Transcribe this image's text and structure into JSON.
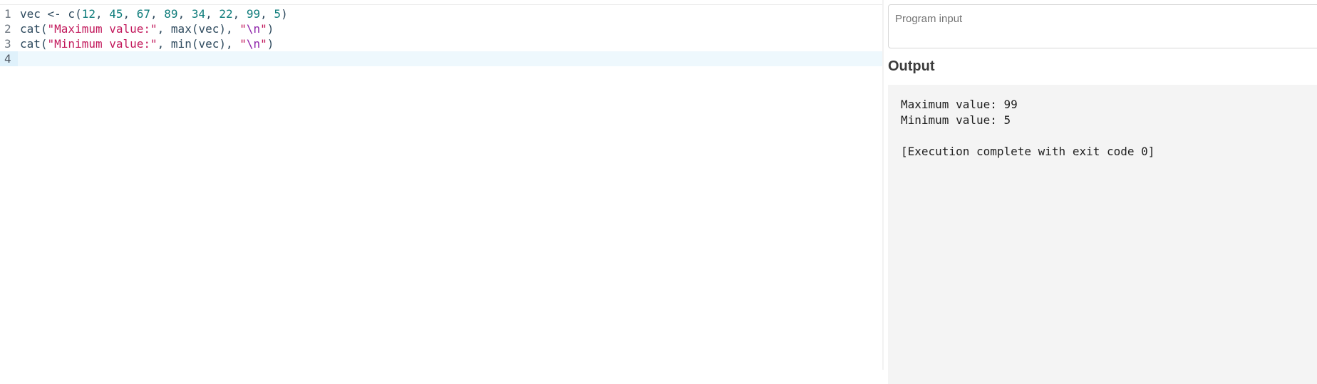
{
  "editor": {
    "lines": [
      {
        "number": "1",
        "tokens": [
          {
            "t": "vec <- c(",
            "k": "plain"
          },
          {
            "t": "12",
            "k": "num"
          },
          {
            "t": ", ",
            "k": "plain"
          },
          {
            "t": "45",
            "k": "num"
          },
          {
            "t": ", ",
            "k": "plain"
          },
          {
            "t": "67",
            "k": "num"
          },
          {
            "t": ", ",
            "k": "plain"
          },
          {
            "t": "89",
            "k": "num"
          },
          {
            "t": ", ",
            "k": "plain"
          },
          {
            "t": "34",
            "k": "num"
          },
          {
            "t": ", ",
            "k": "plain"
          },
          {
            "t": "22",
            "k": "num"
          },
          {
            "t": ", ",
            "k": "plain"
          },
          {
            "t": "99",
            "k": "num"
          },
          {
            "t": ", ",
            "k": "plain"
          },
          {
            "t": "5",
            "k": "num"
          },
          {
            "t": ")",
            "k": "plain"
          }
        ]
      },
      {
        "number": "2",
        "tokens": [
          {
            "t": "cat(",
            "k": "plain"
          },
          {
            "t": "\"Maximum value:\"",
            "k": "str"
          },
          {
            "t": ", max(vec), ",
            "k": "plain"
          },
          {
            "t": "\"",
            "k": "str"
          },
          {
            "t": "\\n",
            "k": "esc"
          },
          {
            "t": "\"",
            "k": "str"
          },
          {
            "t": ")",
            "k": "plain"
          }
        ]
      },
      {
        "number": "3",
        "tokens": [
          {
            "t": "cat(",
            "k": "plain"
          },
          {
            "t": "\"Minimum value:\"",
            "k": "str"
          },
          {
            "t": ", min(vec), ",
            "k": "plain"
          },
          {
            "t": "\"",
            "k": "str"
          },
          {
            "t": "\\n",
            "k": "esc"
          },
          {
            "t": "\"",
            "k": "str"
          },
          {
            "t": ")",
            "k": "plain"
          }
        ]
      },
      {
        "number": "4",
        "active": true,
        "tokens": []
      }
    ]
  },
  "input": {
    "placeholder": "Program input",
    "value": ""
  },
  "output": {
    "title": "Output",
    "lines": [
      "Maximum value: 99",
      "Minimum value: 5",
      "",
      "[Execution complete with exit code 0]"
    ]
  },
  "colors": {
    "number": "#0e7c7b",
    "string": "#c2185b",
    "escape": "#8e24aa",
    "active_line": "#eef8fd",
    "output_bg": "#f4f4f4"
  }
}
